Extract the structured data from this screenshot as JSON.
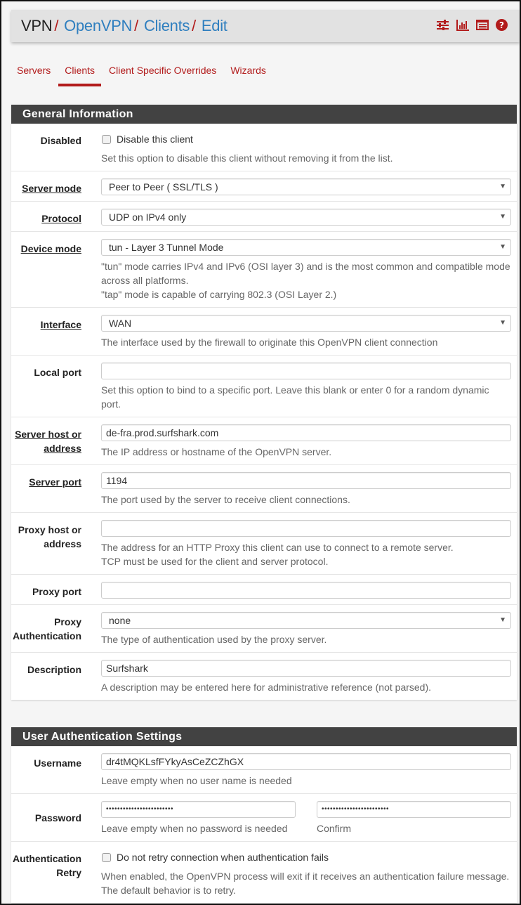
{
  "breadcrumb": {
    "root": "VPN",
    "items": [
      "OpenVPN",
      "Clients",
      "Edit"
    ],
    "separator": "/"
  },
  "header_icons": [
    "sliders-icon",
    "bar-chart-icon",
    "list-table-icon",
    "help-circle-icon"
  ],
  "colors": {
    "accent": "#b21b1b",
    "link": "#2f7fbf",
    "panel_header": "#424242"
  },
  "tabs": [
    {
      "label": "Servers",
      "active": false
    },
    {
      "label": "Clients",
      "active": true
    },
    {
      "label": "Client Specific Overrides",
      "active": false
    },
    {
      "label": "Wizards",
      "active": false
    }
  ],
  "general": {
    "title": "General Information",
    "disabled": {
      "label": "Disabled",
      "checkbox_label": "Disable this client",
      "checked": false,
      "help": "Set this option to disable this client without removing it from the list."
    },
    "server_mode": {
      "label": "Server mode",
      "value": "Peer to Peer ( SSL/TLS )"
    },
    "protocol": {
      "label": "Protocol",
      "value": "UDP on IPv4 only"
    },
    "device_mode": {
      "label": "Device mode",
      "value": "tun - Layer 3 Tunnel Mode",
      "help1": "\"tun\" mode carries IPv4 and IPv6 (OSI layer 3) and is the most common and compatible mode across all platforms.",
      "help2": "\"tap\" mode is capable of carrying 802.3 (OSI Layer 2.)"
    },
    "interface": {
      "label": "Interface",
      "value": "WAN",
      "help": "The interface used by the firewall to originate this OpenVPN client connection"
    },
    "local_port": {
      "label": "Local port",
      "value": "",
      "help": "Set this option to bind to a specific port. Leave this blank or enter 0 for a random dynamic port."
    },
    "server_host": {
      "label_line1": "Server host or",
      "label_line2": "address",
      "value": "de-fra.prod.surfshark.com",
      "help": "The IP address or hostname of the OpenVPN server."
    },
    "server_port": {
      "label": "Server port",
      "value": "1194",
      "help": "The port used by the server to receive client connections."
    },
    "proxy_host": {
      "label_line1": "Proxy host or",
      "label_line2": "address",
      "value": "",
      "help1": "The address for an HTTP Proxy this client can use to connect to a remote server.",
      "help2": "TCP must be used for the client and server protocol."
    },
    "proxy_port": {
      "label": "Proxy port",
      "value": ""
    },
    "proxy_auth": {
      "label_line1": "Proxy",
      "label_line2": "Authentication",
      "value": "none",
      "help": "The type of authentication used by the proxy server."
    },
    "description": {
      "label": "Description",
      "value": "Surfshark",
      "help": "A description may be entered here for administrative reference (not parsed)."
    }
  },
  "user_auth": {
    "title": "User Authentication Settings",
    "username": {
      "label": "Username",
      "value": "dr4tMQKLsfFYkyAsCeZCZhGX",
      "help": "Leave empty when no user name is needed"
    },
    "password": {
      "label": "Password",
      "value": "••••••••••••••••••••••••",
      "confirm_value": "••••••••••••••••••••••••",
      "help": "Leave empty when no password is needed",
      "confirm_help": "Confirm"
    },
    "auth_retry": {
      "label_line1": "Authentication",
      "label_line2": "Retry",
      "checkbox_label": "Do not retry connection when authentication fails",
      "checked": false,
      "help1": "When enabled, the OpenVPN process will exit if it receives an authentication failure message.",
      "help2": "The default behavior is to retry."
    }
  }
}
